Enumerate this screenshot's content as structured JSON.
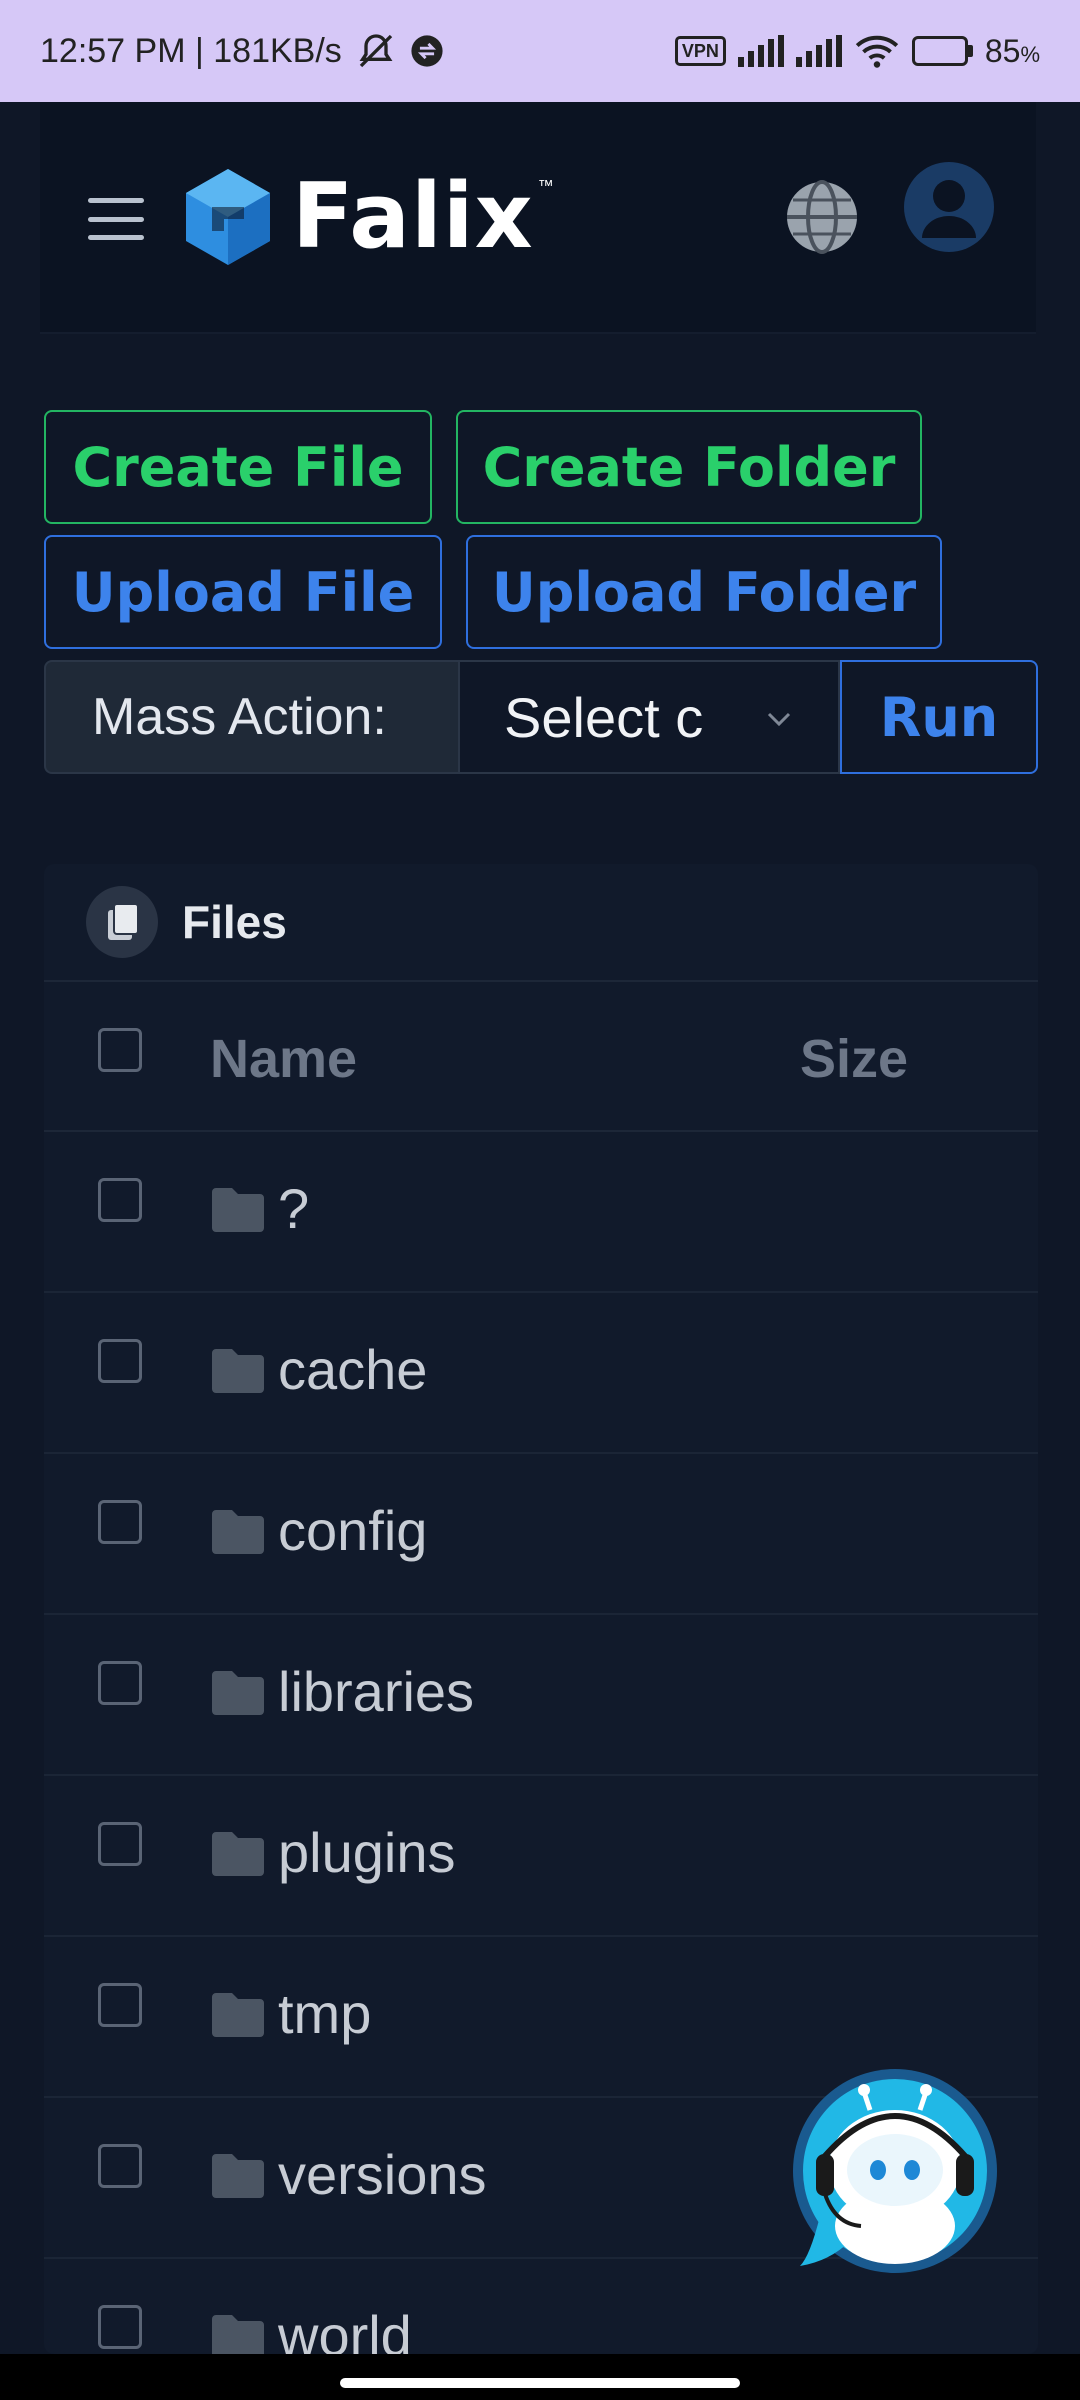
{
  "status_bar": {
    "time_speed": "12:57 PM | 181KB/s",
    "vpn": "VPN",
    "battery": "85",
    "battery_unit": "%",
    "battery_level": 0.85
  },
  "header": {
    "logo_text": "Falix",
    "logo_tm": "™"
  },
  "actions": {
    "create_file": "Create File",
    "create_folder": "Create Folder",
    "upload_file": "Upload File",
    "upload_folder": "Upload Folder"
  },
  "mass_action": {
    "label": "Mass Action:",
    "select_value": "Select c",
    "run": "Run"
  },
  "files": {
    "title": "Files",
    "columns": {
      "name": "Name",
      "size": "Size"
    },
    "rows": [
      {
        "name": "?"
      },
      {
        "name": "cache"
      },
      {
        "name": "config"
      },
      {
        "name": "libraries"
      },
      {
        "name": "plugins"
      },
      {
        "name": "tmp"
      },
      {
        "name": "versions"
      },
      {
        "name": "world"
      }
    ]
  },
  "colors": {
    "status_bar_bg": "#d6c8f7",
    "page_bg": "#0f1727",
    "green": "#2ad06b",
    "blue": "#3d83ec",
    "chatbot_ring": "#1f9fd8"
  }
}
